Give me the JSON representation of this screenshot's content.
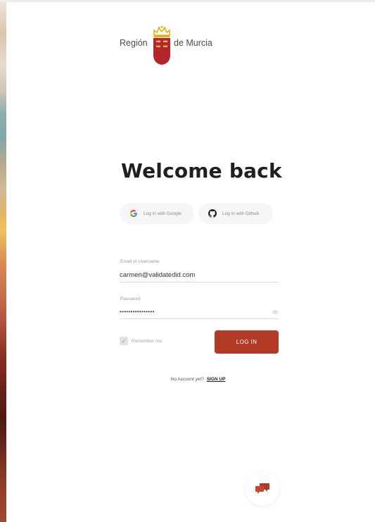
{
  "logo": {
    "text_left": "Región",
    "text_right": "de Murcia",
    "crest_icon": "murcia-crest-icon",
    "crest_color": "#b6242c",
    "crown_color": "#e0b21a"
  },
  "page": {
    "title": "Welcome back"
  },
  "social": {
    "google_label": "Log in with Google",
    "github_label": "Log in with Github"
  },
  "form": {
    "email_label": "Email or Username",
    "email_value": "carmen@validatedid.com",
    "password_label": "Password",
    "password_value": "••••••••••••••••",
    "remember_label": "Remember me",
    "remember_checked": true,
    "login_label": "LOG IN"
  },
  "signup": {
    "prompt": "No Account yet?",
    "link": "SIGN UP"
  },
  "colors": {
    "accent": "#b33a25",
    "background": "#ffffff"
  },
  "chat": {
    "icon": "chat-bubbles-icon"
  }
}
